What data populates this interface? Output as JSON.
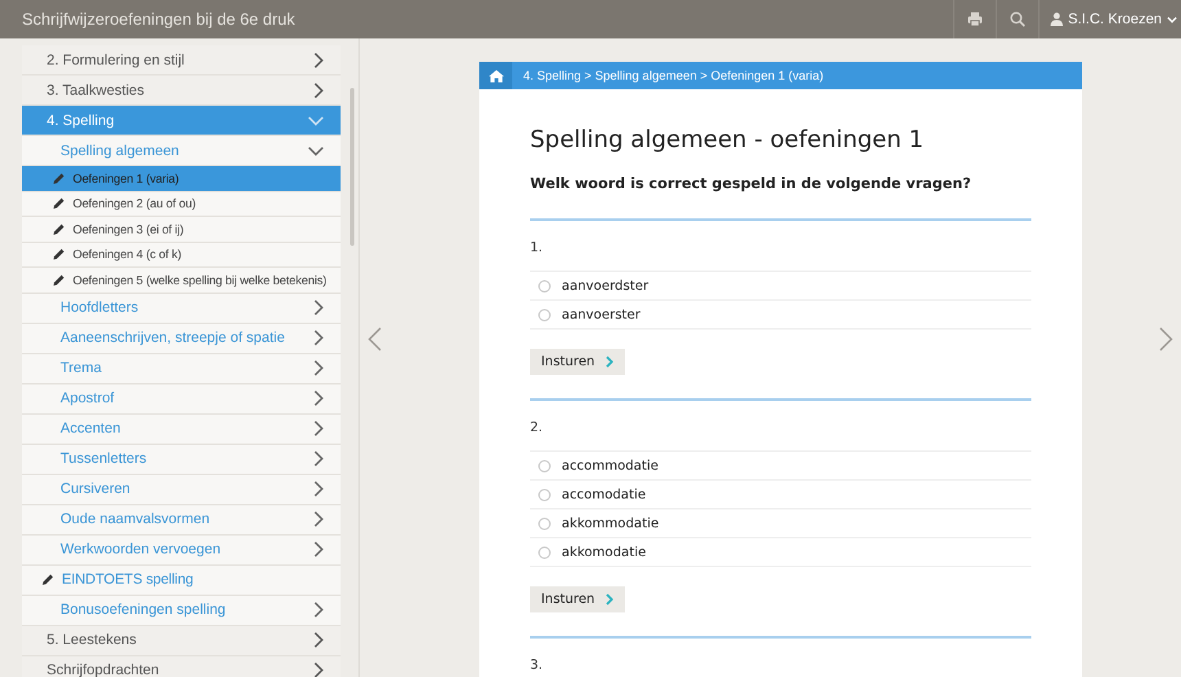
{
  "topbar": {
    "title": "Schrijfwijzeroefeningen bij de 6e druk",
    "user": "S.I.C. Kroezen"
  },
  "sidebar": {
    "items": [
      {
        "label": "2. Formulering en stijl",
        "kind": "section",
        "expanded": false,
        "selected": false
      },
      {
        "label": "3. Taalkwesties",
        "kind": "section",
        "expanded": false,
        "selected": false
      },
      {
        "label": "4. Spelling",
        "kind": "section",
        "expanded": true,
        "selected": true,
        "children": [
          {
            "label": "Spelling algemeen",
            "kind": "section",
            "expanded": true,
            "selected": false,
            "children": [
              {
                "label": "Oefeningen 1 (varia)",
                "kind": "exercise",
                "selected": true
              },
              {
                "label": "Oefeningen 2 (au of ou)",
                "kind": "exercise",
                "selected": false
              },
              {
                "label": "Oefeningen 3 (ei of ij)",
                "kind": "exercise",
                "selected": false
              },
              {
                "label": "Oefeningen 4 (c of k)",
                "kind": "exercise",
                "selected": false
              },
              {
                "label": "Oefeningen 5 (welke spelling bij welke betekenis)",
                "kind": "exercise",
                "selected": false
              }
            ]
          },
          {
            "label": "Hoofdletters",
            "kind": "section",
            "expanded": false,
            "selected": false
          },
          {
            "label": "Aaneenschrijven, streepje of spatie",
            "kind": "section",
            "expanded": false,
            "selected": false
          },
          {
            "label": "Trema",
            "kind": "section",
            "expanded": false,
            "selected": false
          },
          {
            "label": "Apostrof",
            "kind": "section",
            "expanded": false,
            "selected": false
          },
          {
            "label": "Accenten",
            "kind": "section",
            "expanded": false,
            "selected": false
          },
          {
            "label": "Tussenletters",
            "kind": "section",
            "expanded": false,
            "selected": false
          },
          {
            "label": "Cursiveren",
            "kind": "section",
            "expanded": false,
            "selected": false
          },
          {
            "label": "Oude naamvalsvormen",
            "kind": "section",
            "expanded": false,
            "selected": false
          },
          {
            "label": "Werkwoorden vervoegen",
            "kind": "section",
            "expanded": false,
            "selected": false
          },
          {
            "label": "EINDTOETS spelling",
            "kind": "exercise",
            "selected": false
          },
          {
            "label": "Bonusoefeningen spelling",
            "kind": "section",
            "expanded": false,
            "selected": false
          }
        ]
      },
      {
        "label": "5. Leestekens",
        "kind": "section",
        "expanded": false,
        "selected": false
      },
      {
        "label": "Schrijfopdrachten",
        "kind": "section",
        "expanded": false,
        "selected": false
      }
    ]
  },
  "main": {
    "breadcrumb": "4. Spelling > Spelling algemeen > Oefeningen 1 (varia)",
    "title": "Spelling algemeen - oefeningen 1",
    "question": "Welk woord is correct gespeld in de volgende vragen?",
    "questions": [
      {
        "number": "1.",
        "options": [
          {
            "label": "aanvoerdster",
            "selected": false
          },
          {
            "label": "aanvoerster",
            "selected": false
          }
        ],
        "submit": "Insturen"
      },
      {
        "number": "2.",
        "options": [
          {
            "label": "accommodatie",
            "selected": false
          },
          {
            "label": "accomodatie",
            "selected": false
          },
          {
            "label": "akkommodatie",
            "selected": false
          },
          {
            "label": "akkomodatie",
            "selected": false
          }
        ],
        "submit": "Insturen"
      },
      {
        "number": "3."
      }
    ]
  }
}
